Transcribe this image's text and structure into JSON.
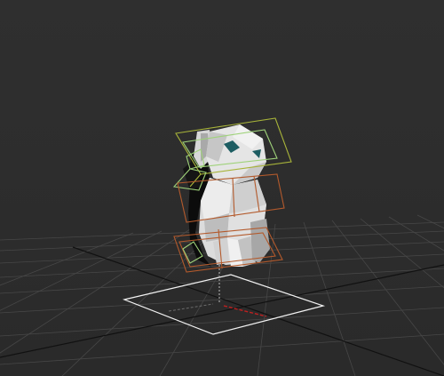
{
  "viewport": {
    "type": "3d-perspective-viewport",
    "colors": {
      "background": "#2e2e2e",
      "grid_line": "#474747",
      "grid_axis": "#101010",
      "model_shade_light": "#e6e6e6",
      "model_shade_mid": "#b9b9b9",
      "model_shade_dark": "#0a0a0a",
      "bone_green": "#9fd27a",
      "bone_olive": "#a8b43a",
      "bone_orange": "#b35a2c",
      "selection_box": "#ffffff",
      "gizmo_x": "#c02020"
    },
    "objects": [
      {
        "name": "low-poly-animal-mesh"
      },
      {
        "name": "head-control-box"
      },
      {
        "name": "body-control-box"
      },
      {
        "name": "pelvis-control-box"
      },
      {
        "name": "root-selection-rectangle"
      }
    ]
  }
}
